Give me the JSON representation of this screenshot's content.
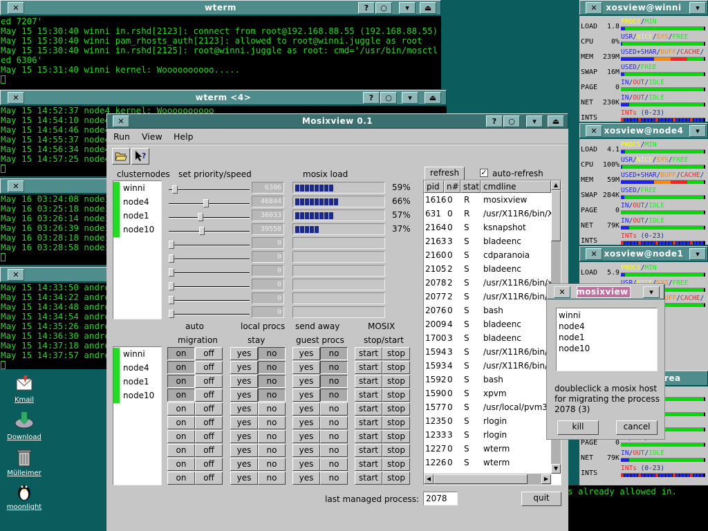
{
  "wterm1": {
    "title": "wterm",
    "lines": [
      "ed 7207'",
      "May 15 15:30:40 winni in.rshd[2123]: connect from root@192.168.88.55 (192.168.88.55)",
      "May 15 15:30:40 winni pam_rhosts_auth[2123]: allowed to root@winni.juggle as root",
      "May 15 15:30:40 winni in.rshd[2125]: root@winni.juggle as root: cmd='/usr/bin/mosctl setspe",
      "ed 6306'",
      "May 15 15:31:40 winni kernel: Woooooooooo....."
    ]
  },
  "wterm2": {
    "title": "wterm <4>",
    "lines": [
      "May 15 14:52:37 node4 kernel: Woooooooooo",
      "May 15 14:54:10 node4",
      "May 15 14:54:46 node4",
      "May 15 14:55:37 node4",
      "May 15 14:56:34 node4",
      "May 15 14:57:25 node4"
    ]
  },
  "wterm3": {
    "lines": [
      "May 16 03:24:08 node1",
      "May 16 03:25:18 node1",
      "May 16 03:26:14 node1",
      "May 16 03:26:39 node1",
      "May 16 03:28:18 node1",
      "May 16 03:28:58 node1"
    ]
  },
  "wterm4": {
    "lines": [
      "May 15 14:33:50 andrea",
      "May 15 14:34:22 andrea",
      "May 15 14:34:48 andrea",
      "May 15 14:34:54 andrea",
      "May 15 14:35:26 andrea",
      "May 15 14:36:30 andrea",
      "May 15 14:37:18 andrea",
      "May 15 14:37:57 andrea"
    ]
  },
  "wterm5": {
    "title": "rea",
    "line": "s already allowed in."
  },
  "desktop_icons": [
    {
      "label": "Kmail"
    },
    {
      "label": "Download"
    },
    {
      "label": "Mülleimer"
    },
    {
      "label": "moonlight"
    }
  ],
  "mosixview": {
    "title": "Mosixview 0.1",
    "menu": [
      "Run",
      "View",
      "Help"
    ],
    "clusternodes_label": "clusternodes",
    "priority_label": "set priority/speed",
    "load_label": "mosix load",
    "nodes": [
      "winni",
      "node4",
      "node1",
      "node10"
    ],
    "speeds": [
      "6306",
      "46844",
      "36033",
      "39558",
      "0",
      "0",
      "0",
      "0",
      "0",
      "0"
    ],
    "slider_levels": [
      0.05,
      0.47,
      0.39,
      0.41,
      0.0,
      0.0,
      0.0,
      0.0,
      0.0,
      0.0
    ],
    "loads": [
      0.59,
      0.66,
      0.57,
      0.37
    ],
    "load_pcts": [
      "59%",
      "66%",
      "57%",
      "37%"
    ],
    "auto_label": "auto",
    "migration_label": "migration",
    "local_procs_label": "local procs",
    "stay_label": "stay",
    "send_away_label": "send away",
    "guest_procs_label": "guest procs",
    "mosix_label": "MOSIX",
    "stopstart_label": "stop/start",
    "on": "on",
    "off": "off",
    "yes": "yes",
    "no": "no",
    "start": "start",
    "stop": "stop",
    "refresh": "refresh",
    "auto_refresh": "auto-refresh",
    "proc_headers": [
      "pid",
      "n#",
      "stat",
      "cmdline"
    ],
    "processes": [
      [
        "1616",
        "0",
        "R",
        "mosixview"
      ],
      [
        "631",
        "0",
        "R",
        "/usr/X11R6/bin/X"
      ],
      [
        "2164",
        "0",
        "S",
        "ksnapshot"
      ],
      [
        "2163",
        "3",
        "S",
        "bladeenc"
      ],
      [
        "2160",
        "0",
        "S",
        "cdparanoia"
      ],
      [
        "2105",
        "2",
        "S",
        "bladeenc"
      ],
      [
        "2078",
        "2",
        "S",
        "/usr/X11R6/bin/x"
      ],
      [
        "2077",
        "2",
        "S",
        "/usr/X11R6/bin/x"
      ],
      [
        "2076",
        "0",
        "S",
        "bash"
      ],
      [
        "2009",
        "4",
        "S",
        "bladeenc"
      ],
      [
        "1700",
        "3",
        "S",
        "bladeenc"
      ],
      [
        "1594",
        "3",
        "S",
        "/usr/X11R6/bin/x"
      ],
      [
        "1593",
        "4",
        "S",
        "/usr/X11R6/bin/x"
      ],
      [
        "1592",
        "0",
        "S",
        "bash"
      ],
      [
        "1590",
        "0",
        "S",
        "xpvm"
      ],
      [
        "1577",
        "0",
        "S",
        "/usr/local/pvm3/"
      ],
      [
        "1235",
        "0",
        "S",
        "rlogin"
      ],
      [
        "1233",
        "3",
        "S",
        "rlogin"
      ],
      [
        "1227",
        "0",
        "S",
        "wterm"
      ],
      [
        "1226",
        "0",
        "S",
        "wterm"
      ]
    ],
    "last_managed_label": "last managed process:",
    "last_managed_value": "2078",
    "quit": "quit"
  },
  "dialog": {
    "title": "mosixview",
    "hosts": [
      "winni",
      "node4",
      "node1",
      "node10"
    ],
    "message": [
      "doubleclick a mosix host",
      "for migrating the process",
      "2078 (3)"
    ],
    "kill": "kill",
    "cancel": "cancel"
  },
  "xosview1": {
    "title": "xosview@winni",
    "rows": [
      {
        "name": "LOAD",
        "value": "1.8",
        "legend": "PROCS/MIN"
      },
      {
        "name": "CPU",
        "value": "0%",
        "legend": "USR/NICE/SYS/FREE"
      },
      {
        "name": "MEM",
        "value": "239M",
        "legend": "USED+SHAR/BUFF/CACHE/"
      },
      {
        "name": "SWAP",
        "value": "16M",
        "legend": "USED/FREE"
      },
      {
        "name": "PAGE",
        "value": "0",
        "legend": "IN/OUT/IDLE"
      },
      {
        "name": "NET",
        "value": "230K",
        "legend": "IN/OUT/IDLE"
      },
      {
        "name": "INTS",
        "value": "",
        "legend": "INTs (0-23)"
      }
    ]
  },
  "xosview2": {
    "title": "xosview@node4",
    "rows": [
      {
        "name": "LOAD",
        "value": "4.1",
        "legend": "PROCS/MIN"
      },
      {
        "name": "CPU",
        "value": "100%",
        "legend": "USR/NICE/SYS/FREE"
      },
      {
        "name": "MEM",
        "value": "59M",
        "legend": "USED+SHAR/BUFF/CACHE/"
      },
      {
        "name": "SWAP",
        "value": "284K",
        "legend": "USED/FREE"
      },
      {
        "name": "PAGE",
        "value": "0",
        "legend": "IN/OUT/IDLE"
      },
      {
        "name": "NET",
        "value": "79K",
        "legend": "IN/OUT/IDLE"
      },
      {
        "name": "INTS",
        "value": "",
        "legend": "INTs (0-23)"
      }
    ]
  },
  "xosview3": {
    "title": "xosview@node1",
    "rows": [
      {
        "name": "LOAD",
        "value": "5.9",
        "legend": "PROCS/MIN"
      },
      {
        "name": "CPU",
        "value": "100%",
        "legend": "USR/NICE/SYS/FREE"
      },
      {
        "name": "",
        "value": "",
        "legend": "USED+SHAR/BUFF/CACHE/"
      }
    ]
  },
  "xosview4": {
    "title": "rea",
    "rows": [
      {
        "name": "",
        "value": "",
        "legend": "SYS/FREE"
      },
      {
        "name": "",
        "value": "",
        "legend": "BUFF/CACHE/"
      },
      {
        "name": "",
        "value": "",
        "legend": ""
      },
      {
        "name": "PAGE",
        "value": "0",
        "legend": "IN/OUT/IDLE"
      },
      {
        "name": "NET",
        "value": "79K",
        "legend": "IN/OUT/IDLE"
      },
      {
        "name": "INTS",
        "value": "",
        "legend": "INTs (0-23)"
      }
    ]
  }
}
